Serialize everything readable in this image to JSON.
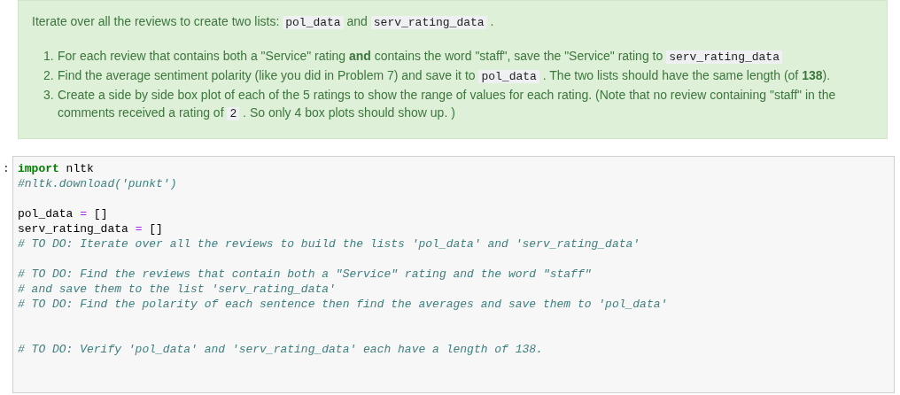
{
  "markdown_cell": {
    "intro": [
      {
        "kind": "text",
        "text": "Iterate over all the reviews to create two lists: "
      },
      {
        "kind": "code",
        "text": "pol_data"
      },
      {
        "kind": "text",
        "text": " and "
      },
      {
        "kind": "code",
        "text": "serv_rating_data"
      },
      {
        "kind": "text",
        "text": " ."
      }
    ],
    "steps": [
      {
        "number": "1.",
        "parts": [
          {
            "kind": "text",
            "text": "For each review that contains both a \"Service\" rating **and** contains the word \"staff\", save the \"Service\" rating to "
          },
          {
            "kind": "code",
            "text": "serv_rating_data"
          }
        ]
      },
      {
        "number": "2.",
        "parts": [
          {
            "kind": "text",
            "text": "Find the average sentiment polarity (like you did in Problem 7) and save it to "
          },
          {
            "kind": "code",
            "text": "pol_data"
          },
          {
            "kind": "text",
            "text": " . The two lists should have the same length (of **138**)."
          }
        ]
      },
      {
        "number": "3.",
        "parts": [
          {
            "kind": "text",
            "text": "Create a side by side box plot of each of the 5 ratings to show the range of values for each rating. (Note that no review containing \"staff\" in the comments received a rating of "
          },
          {
            "kind": "code",
            "text": "2"
          },
          {
            "kind": "text",
            "text": " . So only 4 box plots should show up. )"
          }
        ]
      }
    ]
  },
  "code_cell": {
    "prompt": ":",
    "lines": [
      {
        "kind": "code",
        "tokens": [
          {
            "kind": "keyword",
            "text": "import"
          },
          {
            "kind": "plain",
            "text": " nltk"
          }
        ]
      },
      {
        "kind": "code",
        "tokens": [
          {
            "kind": "comment",
            "text": "#nltk.download('punkt')"
          }
        ]
      },
      {
        "kind": "blank"
      },
      {
        "kind": "code",
        "tokens": [
          {
            "kind": "plain",
            "text": "pol_data "
          },
          {
            "kind": "operator",
            "text": "="
          },
          {
            "kind": "plain",
            "text": " []"
          }
        ]
      },
      {
        "kind": "code",
        "tokens": [
          {
            "kind": "plain",
            "text": "serv_rating_data "
          },
          {
            "kind": "operator",
            "text": "="
          },
          {
            "kind": "plain",
            "text": " []"
          }
        ]
      },
      {
        "kind": "code",
        "tokens": [
          {
            "kind": "comment",
            "text": "# TO DO: Iterate over all the reviews to build the lists 'pol_data' and 'serv_rating_data'"
          }
        ]
      },
      {
        "kind": "blank"
      },
      {
        "kind": "code",
        "tokens": [
          {
            "kind": "comment",
            "text": "# TO DO: Find the reviews that contain both a \"Service\" rating and the word \"staff\""
          }
        ]
      },
      {
        "kind": "code",
        "tokens": [
          {
            "kind": "comment",
            "text": "# and save them to the list 'serv_rating_data'"
          }
        ]
      },
      {
        "kind": "code",
        "tokens": [
          {
            "kind": "comment",
            "text": "# TO DO: Find the polarity of each sentence then find the averages and save them to 'pol_data'"
          }
        ]
      },
      {
        "kind": "blank"
      },
      {
        "kind": "blank"
      },
      {
        "kind": "code",
        "tokens": [
          {
            "kind": "comment",
            "text": "# TO DO: Verify 'pol_data' and 'serv_rating_data' each have a length of 138."
          }
        ]
      }
    ]
  }
}
